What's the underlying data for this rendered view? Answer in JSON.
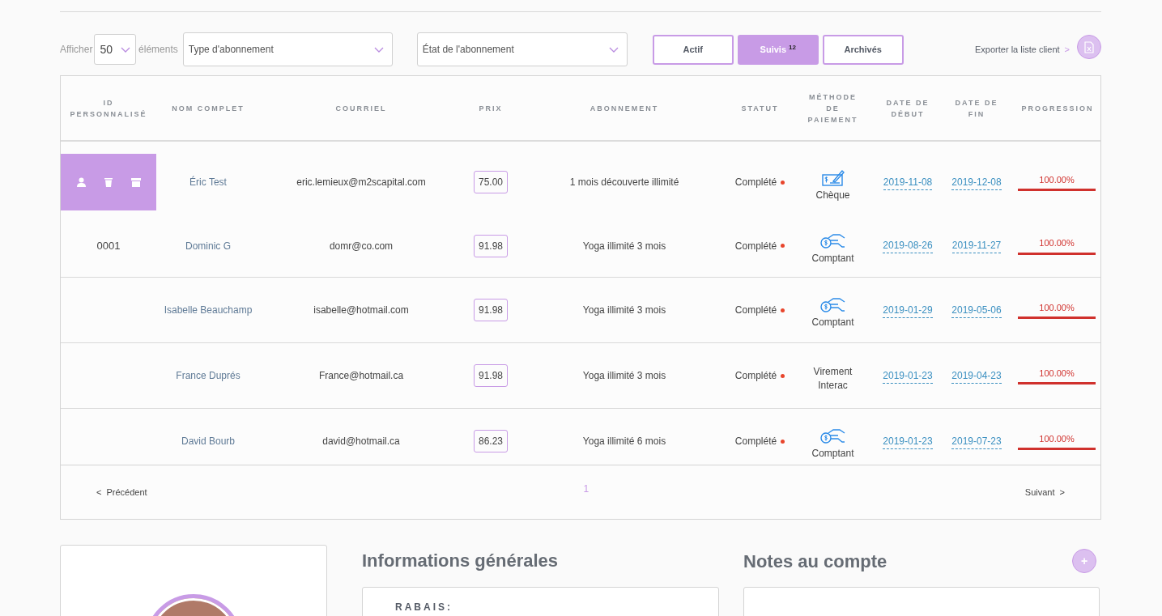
{
  "toolbar": {
    "show_label": "Afficher",
    "page_size": "50",
    "items_label": "éléments",
    "type_filter": {
      "placeholder": "Type d'abonnement"
    },
    "state_filter": {
      "placeholder": "État de l'abonnement"
    },
    "tabs": [
      {
        "label": "Actif",
        "selected": false
      },
      {
        "label": "Suivis",
        "badge": "12",
        "selected": true
      },
      {
        "label": "Archivés",
        "selected": false
      }
    ],
    "export_label": "Exporter la liste client",
    "export_arrow": ">"
  },
  "table": {
    "columns": [
      "ID PERSONNALISÉ",
      "NOM COMPLET",
      "COURRIEL",
      "PRIX",
      "ABONNEMENT",
      "STATUT",
      "MÉTHODE DE PAIEMENT",
      "DATE DE DÉBUT",
      "DATE DE FIN",
      "PROGRESSION"
    ],
    "rows": [
      {
        "actions_visible": true,
        "name": "Éric Test",
        "email": "eric.lemieux@m2scapital.com",
        "price": "75.00",
        "subscription": "1 mois découverte illimité",
        "status": "Complété",
        "payment": {
          "kind": "cheque",
          "label": "Chèque"
        },
        "start": "2019-11-08",
        "end": "2019-12-08",
        "progress": "100.00%",
        "level": 1
      },
      {
        "actions_visible": false,
        "id": "0001",
        "name": "Dominic G",
        "email": "domr@co.com",
        "price": "91.98",
        "subscription": "Yoga illimité 3 mois",
        "status": "Complété",
        "payment": {
          "kind": "cash",
          "label": "Comptant"
        },
        "start": "2019-08-26",
        "end": "2019-11-27",
        "progress": "100.00%",
        "level": 1
      },
      {
        "actions_visible": false,
        "name": "Isabelle Beauchamp",
        "email": "isabelle@hotmail.com",
        "price": "91.98",
        "subscription": "Yoga illimité 3 mois",
        "status": "Complété",
        "payment": {
          "kind": "cash",
          "label": "Comptant"
        },
        "start": "2019-01-29",
        "end": "2019-05-06",
        "progress": "100.00%",
        "level": 1
      },
      {
        "actions_visible": false,
        "name": "France Duprés",
        "email": "France@hotmail.ca",
        "price": "91.98",
        "subscription": "Yoga illimité 3 mois",
        "status": "Complété",
        "payment": {
          "kind": "transfer",
          "label": "Virement Interac"
        },
        "start": "2019-01-23",
        "end": "2019-04-23",
        "progress": "100.00%",
        "level": 1
      },
      {
        "actions_visible": false,
        "name": "David Bourb",
        "email": "david@hotmail.ca",
        "price": "86.23",
        "subscription": "Yoga illimité 6 mois",
        "status": "Complété",
        "payment": {
          "kind": "cash",
          "label": "Comptant"
        },
        "start": "2019-01-23",
        "end": "2019-07-23",
        "progress": "100.00%",
        "level": 1
      }
    ]
  },
  "pagination": {
    "prev_arrow": "<",
    "prev": "Précédent",
    "pages": [
      {
        "label": "1",
        "selected": true
      }
    ],
    "next": "Suivant",
    "next_arrow": ">"
  },
  "general_info": {
    "title": "Informations générales",
    "field_label": "RABAIS:"
  },
  "notes": {
    "title": "Notes au compte",
    "add": "+"
  }
}
